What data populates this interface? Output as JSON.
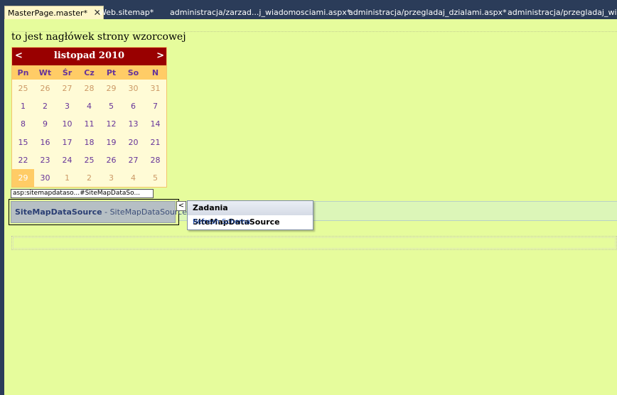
{
  "tabs": [
    {
      "label": "MasterPage.master*",
      "active": true
    },
    {
      "label": "Web.sitemap*"
    },
    {
      "label": "administracja/zarzad...j_wiadomosciami.aspx*"
    },
    {
      "label": "administracja/przegladaj_dzialami.aspx*"
    },
    {
      "label": "administracja/przegladaj_wiadom"
    }
  ],
  "close_glyph": "✕",
  "header_text": "to jest nagłówek strony wzorcowej",
  "calendar": {
    "prev": "<",
    "next": ">",
    "title": "listopad 2010",
    "weekdays": [
      "Pn",
      "Wt",
      "Śr",
      "Cz",
      "Pt",
      "So",
      "N"
    ],
    "weeks": [
      [
        "25",
        "26",
        "27",
        "28",
        "29",
        "30",
        "31"
      ],
      [
        "1",
        "2",
        "3",
        "4",
        "5",
        "6",
        "7"
      ],
      [
        "8",
        "9",
        "10",
        "11",
        "12",
        "13",
        "14"
      ],
      [
        "15",
        "16",
        "17",
        "18",
        "19",
        "20",
        "21"
      ],
      [
        "22",
        "23",
        "24",
        "25",
        "26",
        "27",
        "28"
      ],
      [
        "29",
        "30",
        "1",
        "2",
        "3",
        "4",
        "5"
      ]
    ],
    "colors": {
      "header_bg": "#990000",
      "weekday_bg": "#ffcc66",
      "day_text": "#663399",
      "other_month_text": "#cc9966",
      "body_bg": "#fffbd6"
    }
  },
  "datasource": {
    "tag": "asp:sitemapdataso...#SiteMapDataSo...",
    "name": "SiteMapDataSource",
    "separator": " - ",
    "id": "SiteMapDataSource1",
    "smart_tag_glyph": "<"
  },
  "tasks_popup": {
    "title": "Zadania SiteMapDataSource",
    "link": "Refresh Schema"
  }
}
